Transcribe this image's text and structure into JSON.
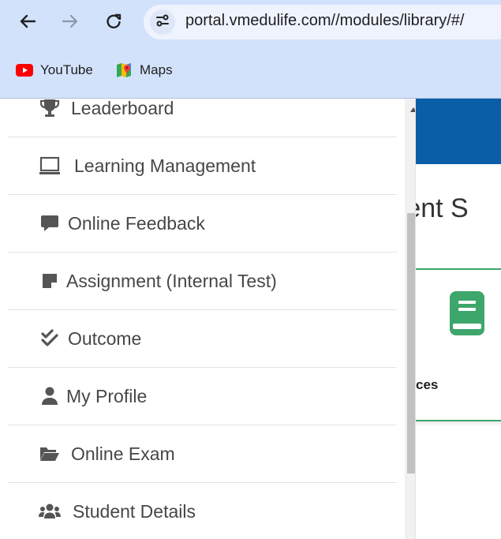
{
  "browser": {
    "url": "portal.vmedulife.com//modules/library/#/",
    "nav": {
      "back_icon": "back-arrow-icon",
      "forward_icon": "forward-arrow-icon",
      "reload_icon": "reload-icon",
      "site_info_icon": "site-settings-icon"
    },
    "bookmarks": [
      {
        "label": "YouTube",
        "icon": "youtube-icon"
      },
      {
        "label": "Maps",
        "icon": "maps-icon"
      }
    ]
  },
  "sidebar": {
    "items": [
      {
        "label": "Leaderboard",
        "icon": "trophy-icon"
      },
      {
        "label": "Learning Management",
        "icon": "laptop-icon"
      },
      {
        "label": "Online Feedback",
        "icon": "comment-icon"
      },
      {
        "label": "Assignment (Internal Test)",
        "icon": "sticky-note-icon"
      },
      {
        "label": "Outcome",
        "icon": "double-check-icon"
      },
      {
        "label": "My Profile",
        "icon": "user-icon"
      },
      {
        "label": "Online Exam",
        "icon": "folder-open-icon"
      },
      {
        "label": "Student Details",
        "icon": "users-icon"
      }
    ]
  },
  "page": {
    "heading_fragment": "ment S",
    "card": {
      "label_fragment": "ces",
      "icon": "book-icon"
    }
  },
  "colors": {
    "chrome_bg": "#d3e2fb",
    "header_blue": "#0a5ea8",
    "card_green": "#3da66b",
    "youtube_red": "#ff0000",
    "menu_text": "#474747",
    "menu_icon": "#555555"
  }
}
